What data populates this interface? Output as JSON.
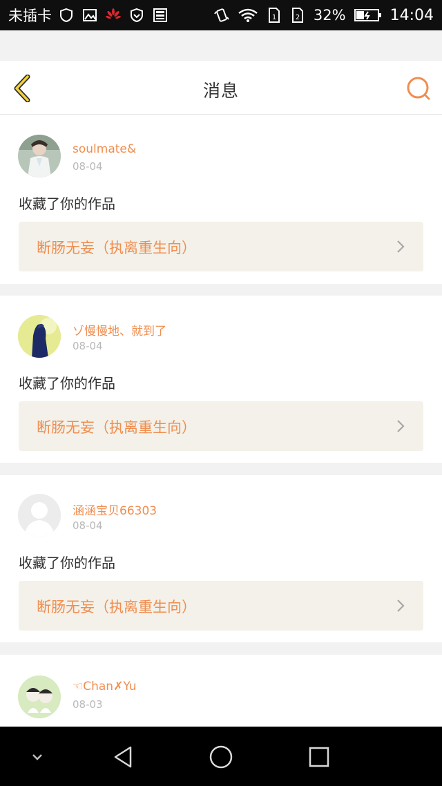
{
  "status_bar": {
    "carrier": "未插卡",
    "battery_percent": "32%",
    "time": "14:04"
  },
  "header": {
    "title": "消息",
    "accent_color": "#f08d4f"
  },
  "messages": [
    {
      "username": "soulmate&",
      "date": "08-04",
      "action": "收藏了你的作品",
      "work_title": "断肠无妄（执离重生向）",
      "avatar": "photo-avatar"
    },
    {
      "username": "ゾ慢慢地、就到了",
      "date": "08-04",
      "action": "收藏了你的作品",
      "work_title": "断肠无妄（执离重生向）",
      "avatar": "silhouette-avatar"
    },
    {
      "username": "涵涵宝贝66303",
      "date": "08-04",
      "action": "收藏了你的作品",
      "work_title": "断肠无妄（执离重生向）",
      "avatar": "default-avatar"
    },
    {
      "username": "☜Chan✗Yu",
      "date": "08-03",
      "avatar": "cartoon-avatar"
    }
  ]
}
